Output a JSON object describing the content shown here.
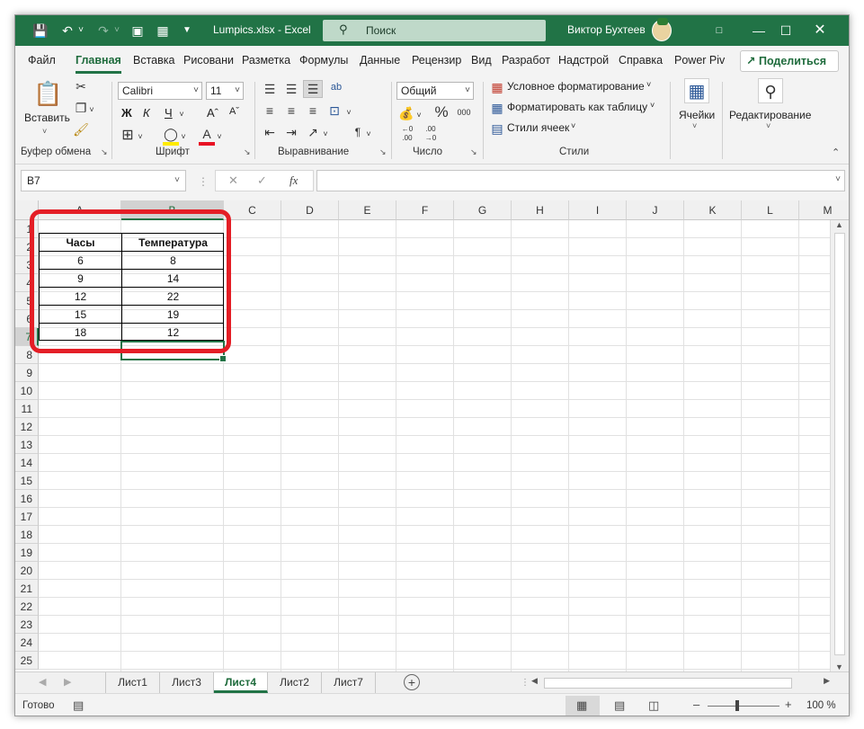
{
  "titlebar": {
    "filename": "Lumpics.xlsx  -  Excel",
    "search_label": "Поиск",
    "user_name": "Виктор Бухтеев",
    "accent": "#217346"
  },
  "menu": {
    "tabs": [
      "Файл",
      "Главная",
      "Вставка",
      "Рисовани",
      "Разметка",
      "Формулы",
      "Данные",
      "Рецензир",
      "Вид",
      "Разработ",
      "Надстрой",
      "Справка",
      "Power Piv"
    ],
    "active_tab": "Главная",
    "share_label": "Поделиться"
  },
  "ribbon": {
    "paste_label": "Вставить",
    "font_name": "Calibri",
    "font_size": "11",
    "number_format": "Общий",
    "conditional_formatting": "Условное форматирование",
    "format_as_table": "Форматировать как таблицу",
    "cell_styles": "Стили ячеек",
    "cells_label": "Ячейки",
    "editing_label": "Редактирование",
    "bold": "Ж",
    "italic": "К",
    "underline": "Ч",
    "groups": {
      "clipboard": "Буфер обмена",
      "font": "Шрифт",
      "alignment": "Выравнивание",
      "number": "Число",
      "styles": "Стили"
    }
  },
  "formula_bar": {
    "name_box": "B7",
    "fx": "fx",
    "value": ""
  },
  "grid": {
    "columns": [
      "A",
      "B",
      "C",
      "D",
      "E",
      "F",
      "G",
      "H",
      "I",
      "J",
      "K",
      "L",
      "M"
    ],
    "selected_column": "B",
    "rows": [
      "1",
      "2",
      "3",
      "4",
      "5",
      "6",
      "7",
      "8",
      "9",
      "10",
      "11",
      "12",
      "13",
      "14",
      "15",
      "16",
      "17",
      "18",
      "19",
      "20",
      "21",
      "22",
      "23",
      "24",
      "25"
    ],
    "selected_row": "7",
    "table": {
      "headers": [
        "Часы",
        "Температура"
      ],
      "rows": [
        [
          "6",
          "8"
        ],
        [
          "9",
          "14"
        ],
        [
          "12",
          "22"
        ],
        [
          "15",
          "19"
        ],
        [
          "18",
          "12"
        ]
      ]
    }
  },
  "sheets": {
    "tabs": [
      "Лист1",
      "Лист3",
      "Лист4",
      "Лист2",
      "Лист7"
    ],
    "active": "Лист4"
  },
  "status": {
    "ready": "Готово",
    "zoom": "100 %"
  }
}
